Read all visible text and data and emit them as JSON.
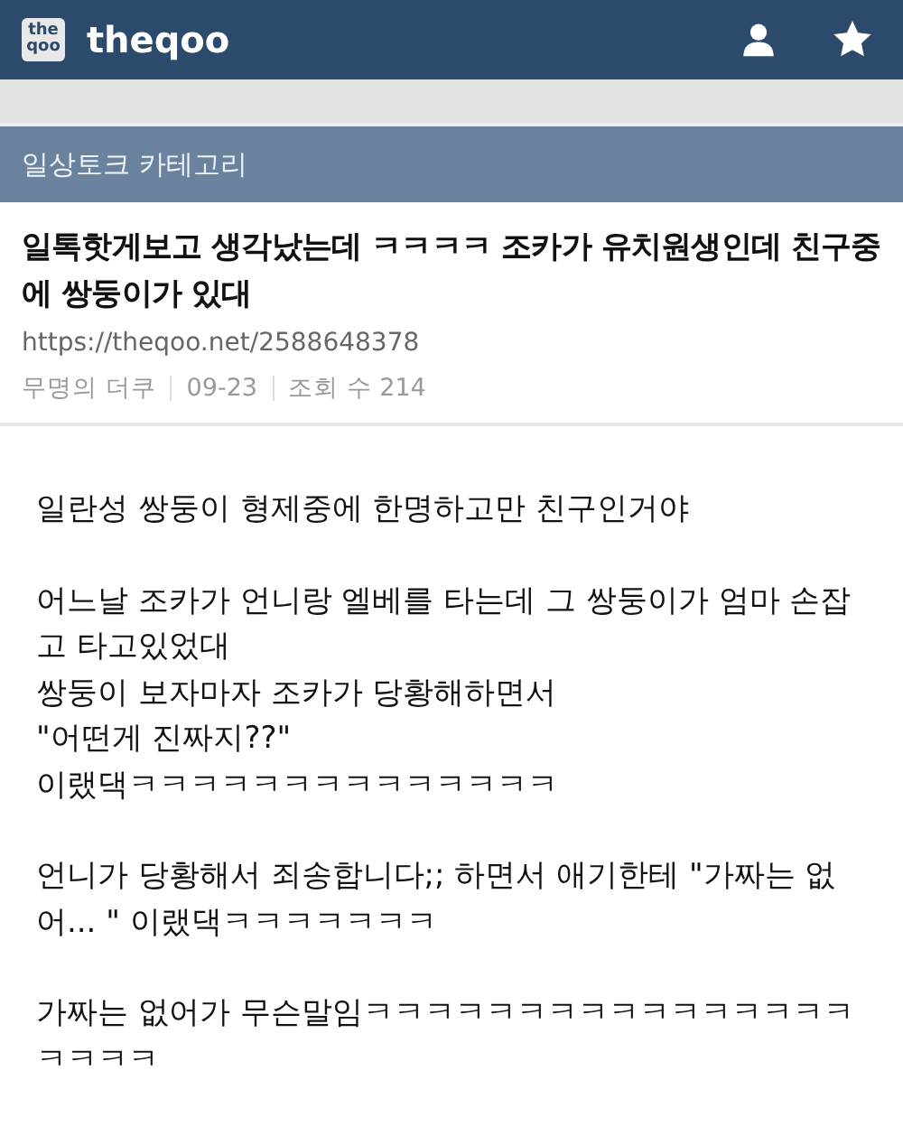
{
  "header": {
    "logo": "theqoo",
    "site_name": "theqoo"
  },
  "category": "일상토크 카테고리",
  "post": {
    "title": "일톡핫게보고 생각났는데 ㅋㅋㅋㅋ 조카가 유치원생인데 친구중에 쌍둥이가 있대",
    "url": "https://theqoo.net/2588648378",
    "author": "무명의 더쿠",
    "date": "09-23",
    "views": "조회 수 214"
  },
  "body": [
    [
      "일란성 쌍둥이 형제중에 한명하고만 친구인거야"
    ],
    [
      "어느날 조카가 언니랑 엘베를 타는데 그 쌍둥이가 엄마 손잡고 타고있었대",
      "쌍둥이 보자마자 조카가 당황해하면서",
      "\"어떤게 진짜지??\"",
      "이랬댁ㅋㅋㅋㅋㅋㅋㅋㅋㅋㅋㅋㅋㅋㅋ"
    ],
    [
      "언니가 당황해서 죄송합니다;; 하면서 애기한테 \"가짜는 없어... \" 이랬댁ㅋㅋㅋㅋㅋㅋㅋ"
    ],
    [
      "가짜는 없어가 무슨말임ㅋㅋㅋㅋㅋㅋㅋㅋㅋㅋㅋㅋㅋㅋㅋㅋㅋㅋㅋㅋ"
    ]
  ]
}
